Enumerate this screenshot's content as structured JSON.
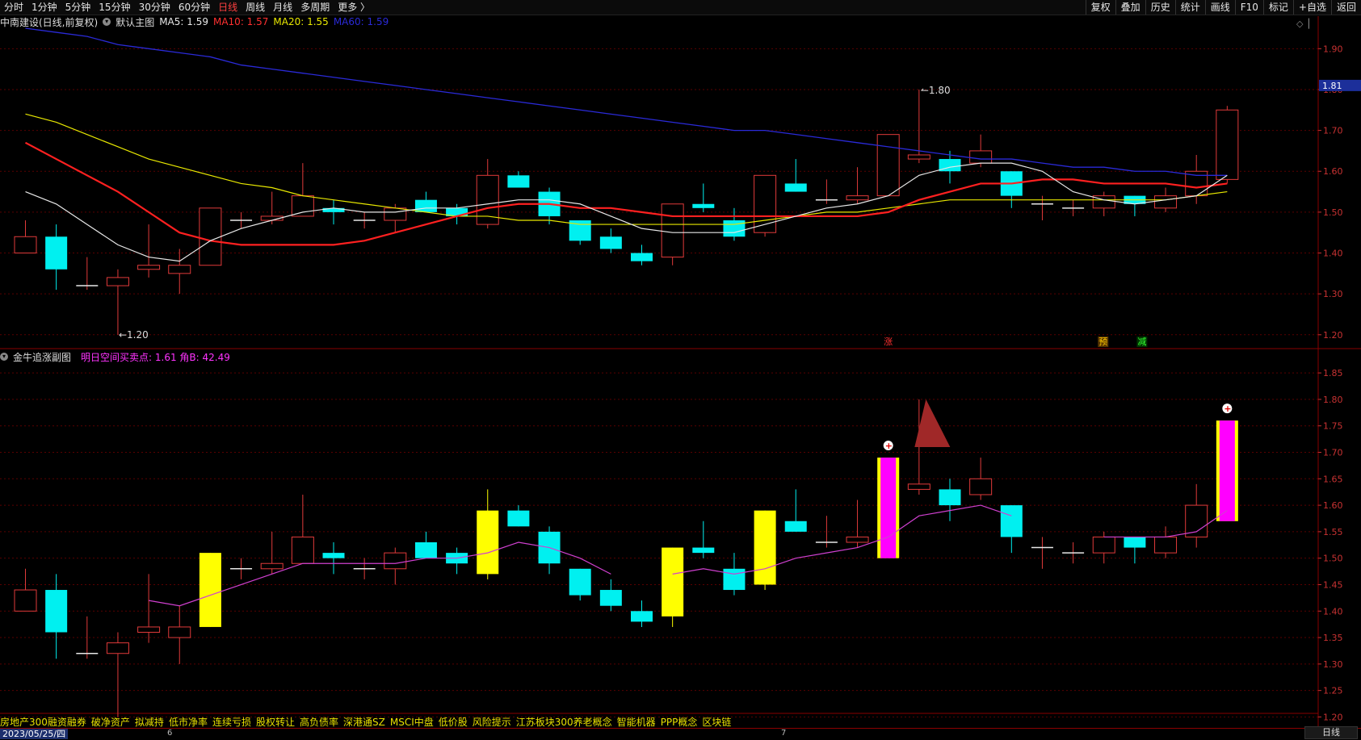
{
  "topbar": {
    "periods": [
      "分时",
      "1分钟",
      "5分钟",
      "15分钟",
      "30分钟",
      "60分钟",
      "日线",
      "周线",
      "月线",
      "多周期",
      "更多 〉"
    ],
    "active_period": "日线",
    "right_buttons": [
      "复权",
      "叠加",
      "历史",
      "统计",
      "画线",
      "F10",
      "+自选",
      "返回"
    ],
    "right_extra": "标记"
  },
  "main_header": {
    "stock": "中南建设(日线,前复权)",
    "chart_name": "默认主图",
    "ma5": "MA5: 1.59",
    "ma10": "MA10: 1.57",
    "ma20": "MA20: 1.55",
    "ma60": "MA60: 1.59",
    "current_price": "1.81",
    "high_label": "1.80",
    "low_label": "1.20",
    "signals": {
      "zhang": "涨",
      "yu": "预",
      "jian": "减"
    },
    "y_ticks": [
      "1.90",
      "1.80",
      "1.70",
      "1.60",
      "1.50",
      "1.40",
      "1.30",
      "1.20"
    ]
  },
  "sub_header": {
    "name": "金牛追涨副图",
    "indicator": "明日空间买卖点: 1.61  角B: 42.49",
    "y_ticks": [
      "1.85",
      "1.80",
      "1.75",
      "1.70",
      "1.65",
      "1.60",
      "1.55",
      "1.50",
      "1.45",
      "1.40",
      "1.35",
      "1.30",
      "1.25",
      "1.20"
    ]
  },
  "concepts": [
    "房地产300融资融券",
    "破净资产",
    "拟减持",
    "低市净率",
    "连续亏损",
    "股权转让",
    "高负债率",
    "深港通SZ",
    "MSCI中盘",
    "低价股",
    "风险提示",
    "江苏板块300养老概念",
    "智能机器",
    "PPP概念",
    "区块链"
  ],
  "date_label": "2023/05/25/四",
  "axis_markers": {
    "m6": "6",
    "m7": "7"
  },
  "period_button": "日线",
  "colors": {
    "up": "#e03a3a",
    "down": "#00f0f0",
    "ma5": "#e8e8e8",
    "ma10": "#ff2020",
    "ma20": "#e8e800",
    "ma60": "#2a2ad8",
    "sub_yellow": "#ffff00",
    "sub_magenta": "#ff00ff"
  },
  "chart_data": {
    "type": "candlestick",
    "ylim": [
      1.17,
      1.95
    ],
    "candles": [
      {
        "o": 1.4,
        "h": 1.48,
        "l": 1.4,
        "c": 1.44
      },
      {
        "o": 1.44,
        "h": 1.47,
        "l": 1.31,
        "c": 1.36
      },
      {
        "o": 1.32,
        "h": 1.39,
        "l": 1.31,
        "c": 1.32
      },
      {
        "o": 1.32,
        "h": 1.36,
        "l": 1.2,
        "c": 1.34
      },
      {
        "o": 1.36,
        "h": 1.47,
        "l": 1.34,
        "c": 1.37
      },
      {
        "o": 1.35,
        "h": 1.41,
        "l": 1.3,
        "c": 1.37
      },
      {
        "o": 1.37,
        "h": 1.51,
        "l": 1.37,
        "c": 1.51
      },
      {
        "o": 1.48,
        "h": 1.5,
        "l": 1.46,
        "c": 1.48
      },
      {
        "o": 1.48,
        "h": 1.55,
        "l": 1.47,
        "c": 1.49
      },
      {
        "o": 1.49,
        "h": 1.62,
        "l": 1.49,
        "c": 1.54
      },
      {
        "o": 1.51,
        "h": 1.53,
        "l": 1.47,
        "c": 1.5
      },
      {
        "o": 1.48,
        "h": 1.5,
        "l": 1.46,
        "c": 1.48
      },
      {
        "o": 1.48,
        "h": 1.52,
        "l": 1.45,
        "c": 1.51
      },
      {
        "o": 1.53,
        "h": 1.55,
        "l": 1.5,
        "c": 1.5
      },
      {
        "o": 1.51,
        "h": 1.52,
        "l": 1.47,
        "c": 1.49
      },
      {
        "o": 1.47,
        "h": 1.63,
        "l": 1.46,
        "c": 1.59
      },
      {
        "o": 1.59,
        "h": 1.6,
        "l": 1.56,
        "c": 1.56
      },
      {
        "o": 1.55,
        "h": 1.56,
        "l": 1.47,
        "c": 1.49
      },
      {
        "o": 1.48,
        "h": 1.48,
        "l": 1.42,
        "c": 1.43
      },
      {
        "o": 1.44,
        "h": 1.46,
        "l": 1.4,
        "c": 1.41
      },
      {
        "o": 1.4,
        "h": 1.42,
        "l": 1.37,
        "c": 1.38
      },
      {
        "o": 1.39,
        "h": 1.52,
        "l": 1.37,
        "c": 1.52
      },
      {
        "o": 1.52,
        "h": 1.57,
        "l": 1.5,
        "c": 1.51
      },
      {
        "o": 1.48,
        "h": 1.51,
        "l": 1.43,
        "c": 1.44
      },
      {
        "o": 1.45,
        "h": 1.59,
        "l": 1.44,
        "c": 1.59
      },
      {
        "o": 1.57,
        "h": 1.63,
        "l": 1.55,
        "c": 1.55
      },
      {
        "o": 1.53,
        "h": 1.58,
        "l": 1.52,
        "c": 1.53
      },
      {
        "o": 1.53,
        "h": 1.61,
        "l": 1.52,
        "c": 1.54
      },
      {
        "o": 1.54,
        "h": 1.69,
        "l": 1.54,
        "c": 1.69
      },
      {
        "o": 1.63,
        "h": 1.8,
        "l": 1.62,
        "c": 1.64
      },
      {
        "o": 1.63,
        "h": 1.65,
        "l": 1.57,
        "c": 1.6
      },
      {
        "o": 1.62,
        "h": 1.69,
        "l": 1.61,
        "c": 1.65
      },
      {
        "o": 1.6,
        "h": 1.6,
        "l": 1.51,
        "c": 1.54
      },
      {
        "o": 1.52,
        "h": 1.54,
        "l": 1.48,
        "c": 1.52
      },
      {
        "o": 1.51,
        "h": 1.53,
        "l": 1.49,
        "c": 1.51
      },
      {
        "o": 1.51,
        "h": 1.55,
        "l": 1.49,
        "c": 1.54
      },
      {
        "o": 1.54,
        "h": 1.54,
        "l": 1.49,
        "c": 1.52
      },
      {
        "o": 1.51,
        "h": 1.56,
        "l": 1.5,
        "c": 1.54
      },
      {
        "o": 1.54,
        "h": 1.64,
        "l": 1.52,
        "c": 1.6
      },
      {
        "o": 1.58,
        "h": 1.76,
        "l": 1.57,
        "c": 1.75
      }
    ],
    "ma5": [
      1.55,
      1.52,
      1.47,
      1.42,
      1.39,
      1.38,
      1.43,
      1.46,
      1.48,
      1.5,
      1.51,
      1.5,
      1.5,
      1.51,
      1.51,
      1.52,
      1.53,
      1.53,
      1.52,
      1.49,
      1.46,
      1.45,
      1.45,
      1.45,
      1.47,
      1.49,
      1.51,
      1.52,
      1.54,
      1.59,
      1.61,
      1.62,
      1.62,
      1.6,
      1.55,
      1.53,
      1.52,
      1.53,
      1.54,
      1.59
    ],
    "ma10": [
      1.67,
      1.63,
      1.59,
      1.55,
      1.5,
      1.45,
      1.43,
      1.42,
      1.42,
      1.42,
      1.42,
      1.43,
      1.45,
      1.47,
      1.49,
      1.51,
      1.52,
      1.52,
      1.51,
      1.51,
      1.5,
      1.49,
      1.49,
      1.49,
      1.49,
      1.49,
      1.49,
      1.49,
      1.5,
      1.53,
      1.55,
      1.57,
      1.57,
      1.58,
      1.58,
      1.57,
      1.57,
      1.57,
      1.56,
      1.57
    ],
    "ma20": [
      1.74,
      1.72,
      1.69,
      1.66,
      1.63,
      1.61,
      1.59,
      1.57,
      1.56,
      1.54,
      1.53,
      1.52,
      1.51,
      1.5,
      1.49,
      1.49,
      1.48,
      1.48,
      1.47,
      1.47,
      1.47,
      1.47,
      1.47,
      1.47,
      1.48,
      1.49,
      1.5,
      1.5,
      1.51,
      1.52,
      1.53,
      1.53,
      1.53,
      1.53,
      1.53,
      1.53,
      1.53,
      1.53,
      1.54,
      1.55
    ],
    "ma60": [
      1.95,
      1.94,
      1.93,
      1.91,
      1.9,
      1.89,
      1.88,
      1.86,
      1.85,
      1.84,
      1.83,
      1.82,
      1.81,
      1.8,
      1.79,
      1.78,
      1.77,
      1.76,
      1.75,
      1.74,
      1.73,
      1.72,
      1.71,
      1.7,
      1.7,
      1.69,
      1.68,
      1.67,
      1.66,
      1.65,
      1.64,
      1.63,
      1.63,
      1.62,
      1.61,
      1.61,
      1.6,
      1.6,
      1.59,
      1.59
    ],
    "sub": {
      "ylim": [
        1.19,
        1.87
      ],
      "yellow_bars": [
        6,
        15,
        21,
        24
      ],
      "magenta_bars": [
        28,
        39
      ],
      "bull_bars": [
        28,
        39
      ],
      "line": [
        null,
        null,
        null,
        null,
        1.42,
        1.41,
        1.43,
        1.45,
        1.47,
        1.49,
        1.49,
        1.49,
        1.49,
        1.5,
        1.5,
        1.51,
        1.53,
        1.52,
        1.5,
        1.47,
        null,
        1.47,
        1.48,
        1.47,
        1.48,
        1.5,
        1.51,
        1.52,
        1.54,
        1.58,
        1.59,
        1.6,
        1.58,
        null,
        null,
        1.54,
        1.54,
        1.54,
        1.55,
        1.59
      ]
    }
  }
}
